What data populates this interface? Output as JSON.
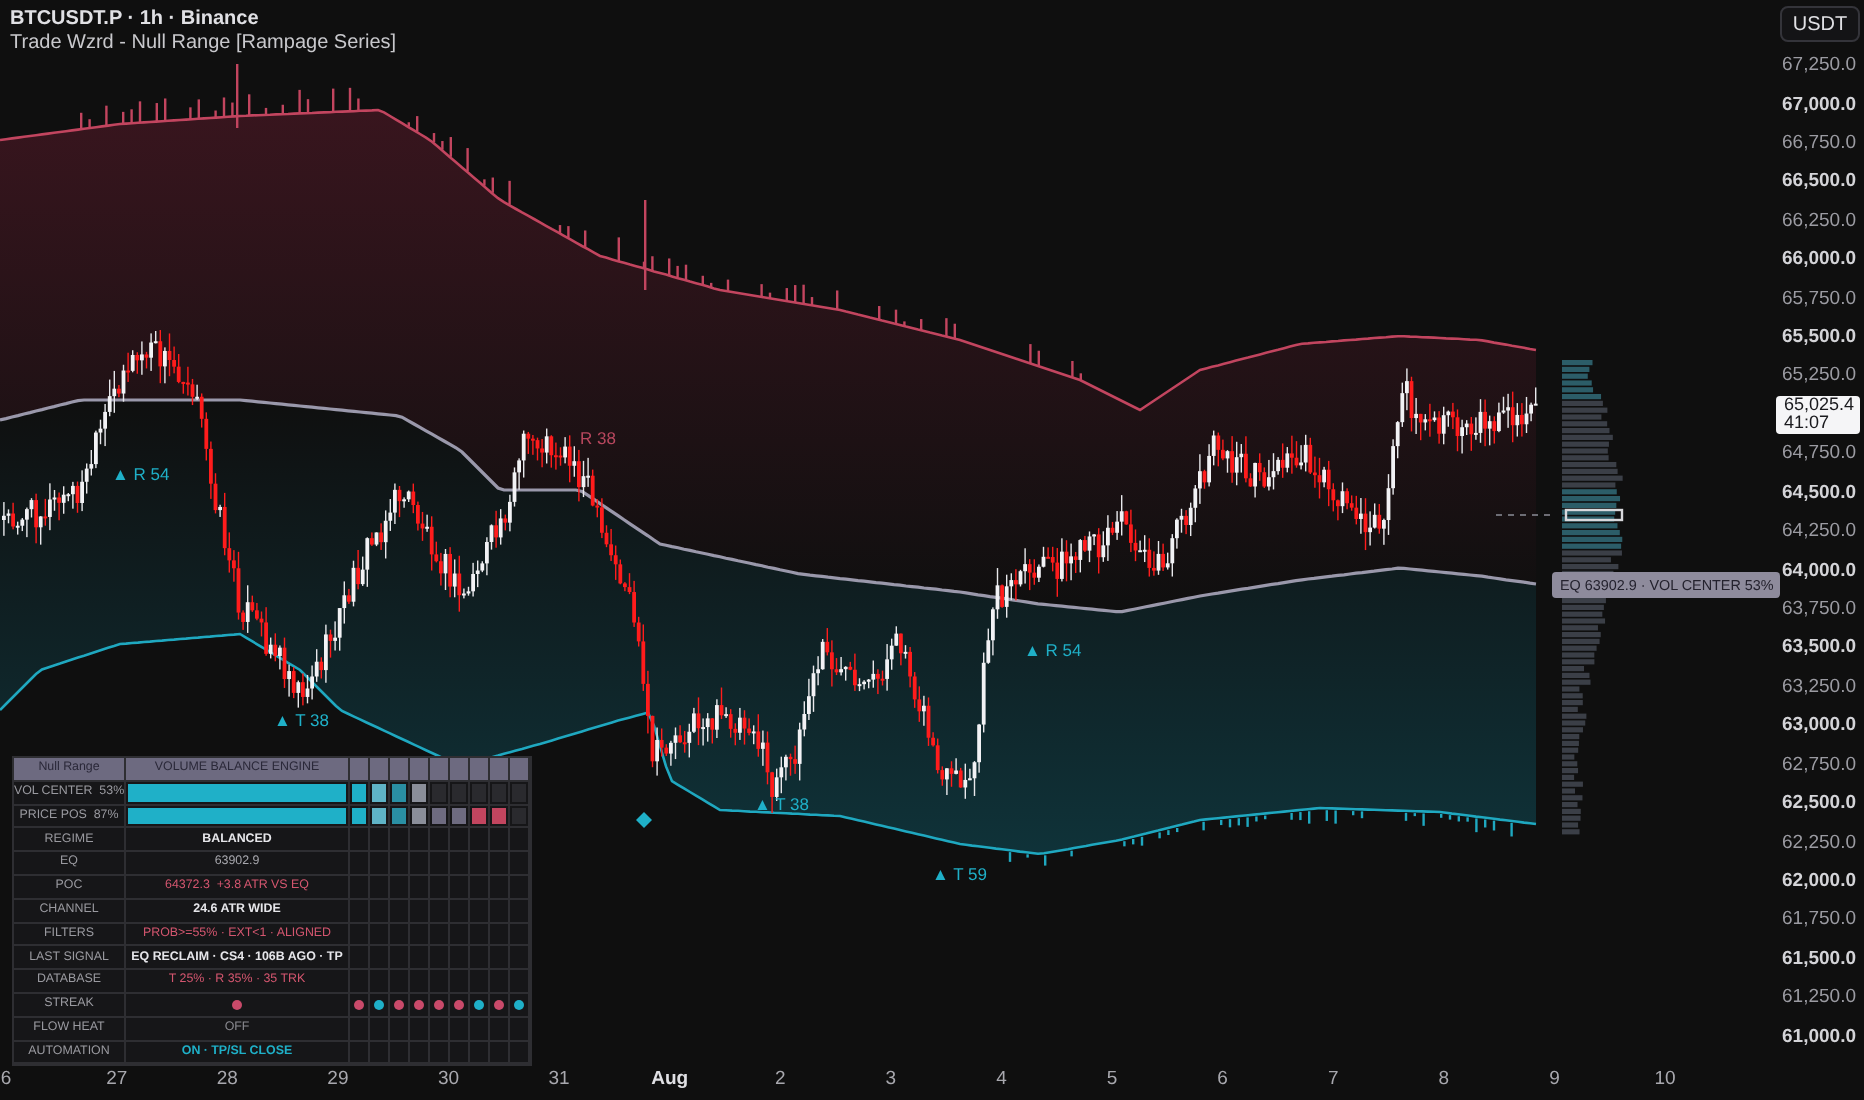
{
  "header": {
    "symbol": "BTCUSDT.P · 1h · Binance",
    "indicator": "Trade Wzrd - Null Range [Rampage Series]"
  },
  "currency_button": "USDT",
  "price_axis": [
    {
      "label": "67,250.0",
      "major": false
    },
    {
      "label": "67,000.0",
      "major": true
    },
    {
      "label": "66,750.0",
      "major": false
    },
    {
      "label": "66,500.0",
      "major": true
    },
    {
      "label": "66,250.0",
      "major": false
    },
    {
      "label": "66,000.0",
      "major": true
    },
    {
      "label": "65,750.0",
      "major": false
    },
    {
      "label": "65,500.0",
      "major": true
    },
    {
      "label": "65,250.0",
      "major": false
    },
    {
      "label": "64,750.0",
      "major": false
    },
    {
      "label": "64,500.0",
      "major": true
    },
    {
      "label": "64,250.0",
      "major": false
    },
    {
      "label": "64,000.0",
      "major": true
    },
    {
      "label": "63,750.0",
      "major": false
    },
    {
      "label": "63,500.0",
      "major": true
    },
    {
      "label": "63,250.0",
      "major": false
    },
    {
      "label": "63,000.0",
      "major": true
    },
    {
      "label": "62,750.0",
      "major": false
    },
    {
      "label": "62,500.0",
      "major": true
    },
    {
      "label": "62,250.0",
      "major": false
    },
    {
      "label": "62,000.0",
      "major": true
    },
    {
      "label": "61,750.0",
      "major": false
    },
    {
      "label": "61,500.0",
      "major": true
    },
    {
      "label": "61,250.0",
      "major": false
    },
    {
      "label": "61,000.0",
      "major": true
    }
  ],
  "last_price": {
    "price": "65,025.4",
    "countdown": "41:07"
  },
  "time_axis": [
    {
      "label": "6",
      "major": false
    },
    {
      "label": "27",
      "major": false
    },
    {
      "label": "28",
      "major": false
    },
    {
      "label": "29",
      "major": false
    },
    {
      "label": "30",
      "major": false
    },
    {
      "label": "31",
      "major": false
    },
    {
      "label": "Aug",
      "major": true
    },
    {
      "label": "2",
      "major": false
    },
    {
      "label": "3",
      "major": false
    },
    {
      "label": "4",
      "major": false
    },
    {
      "label": "5",
      "major": false
    },
    {
      "label": "6",
      "major": false
    },
    {
      "label": "7",
      "major": false
    },
    {
      "label": "8",
      "major": false
    },
    {
      "label": "9",
      "major": false
    },
    {
      "label": "10",
      "major": false
    }
  ],
  "chart_labels": [
    {
      "text": "▲ R 54",
      "kind": "bull"
    },
    {
      "text": "R 38",
      "kind": "bear"
    },
    {
      "text": "▲ T 38",
      "kind": "bull"
    },
    {
      "text": "▲ T 38",
      "kind": "bull"
    },
    {
      "text": "▲ T 59",
      "kind": "bull"
    },
    {
      "text": "▲ R 54",
      "kind": "bull"
    }
  ],
  "eq_tag": "EQ 63902.9 · VOL CENTER 53%",
  "table": {
    "title": "Null Range",
    "engine": "VOLUME BALANCE ENGINE",
    "meters": [
      {
        "label": "VOL CENTER  53%",
        "cells": [
          {
            "color": "#1fb0c8"
          },
          {
            "color": "#5fb3c6"
          },
          {
            "color": "#2a8fa3"
          },
          {
            "color": "#8a8e99"
          },
          {
            "color": "#2a2a2e"
          },
          {
            "color": "#2a2a2e"
          },
          {
            "color": "#2a2a2e"
          },
          {
            "color": "#2a2a2e"
          },
          {
            "color": "#2a2a2e"
          }
        ]
      },
      {
        "label": "PRICE POS  87%",
        "cells": [
          {
            "color": "#1fb0c8"
          },
          {
            "color": "#5fb3c6"
          },
          {
            "color": "#2a8fa3"
          },
          {
            "color": "#8a8e99"
          },
          {
            "color": "#6e6b80"
          },
          {
            "color": "#6e6b80"
          },
          {
            "color": "#c2455f"
          },
          {
            "color": "#c2455f"
          },
          {
            "color": "#2a2a2e"
          }
        ]
      }
    ],
    "rows": [
      {
        "label": "REGIME",
        "value": "BALANCED",
        "kind": "strong"
      },
      {
        "label": "EQ",
        "value": "63902.9",
        "kind": "plain"
      },
      {
        "label": "POC",
        "value": "64372.3  +3.8 ATR VS EQ",
        "kind": "bear"
      },
      {
        "label": "CHANNEL",
        "value": "24.6 ATR WIDE",
        "kind": "strong"
      },
      {
        "label": "FILTERS",
        "value": "PROB>=55% · EXT<1 · ALIGNED",
        "kind": "bear"
      },
      {
        "label": "LAST SIGNAL",
        "value": "EQ RECLAIM · CS4 · 106B AGO · TP",
        "kind": "strong"
      },
      {
        "label": "DATABASE",
        "value": "T 25% · R 35% · 35 TRK",
        "kind": "bear"
      }
    ],
    "streak": {
      "label": "STREAK",
      "current": {
        "color": "#c94a6a"
      },
      "dots": [
        {
          "color": "#c94a6a"
        },
        {
          "color": "#1fb0c8"
        },
        {
          "color": "#c94a6a"
        },
        {
          "color": "#c94a6a"
        },
        {
          "color": "#c94a6a"
        },
        {
          "color": "#c94a6a"
        },
        {
          "color": "#1fb0c8"
        },
        {
          "color": "#c94a6a"
        },
        {
          "color": "#1fb0c8"
        }
      ]
    },
    "tail_rows": [
      {
        "label": "FLOW HEAT",
        "value": "OFF",
        "kind": "muted"
      },
      {
        "label": "AUTOMATION",
        "value": "ON · TP/SL CLOSE",
        "kind": "bull"
      }
    ]
  }
}
